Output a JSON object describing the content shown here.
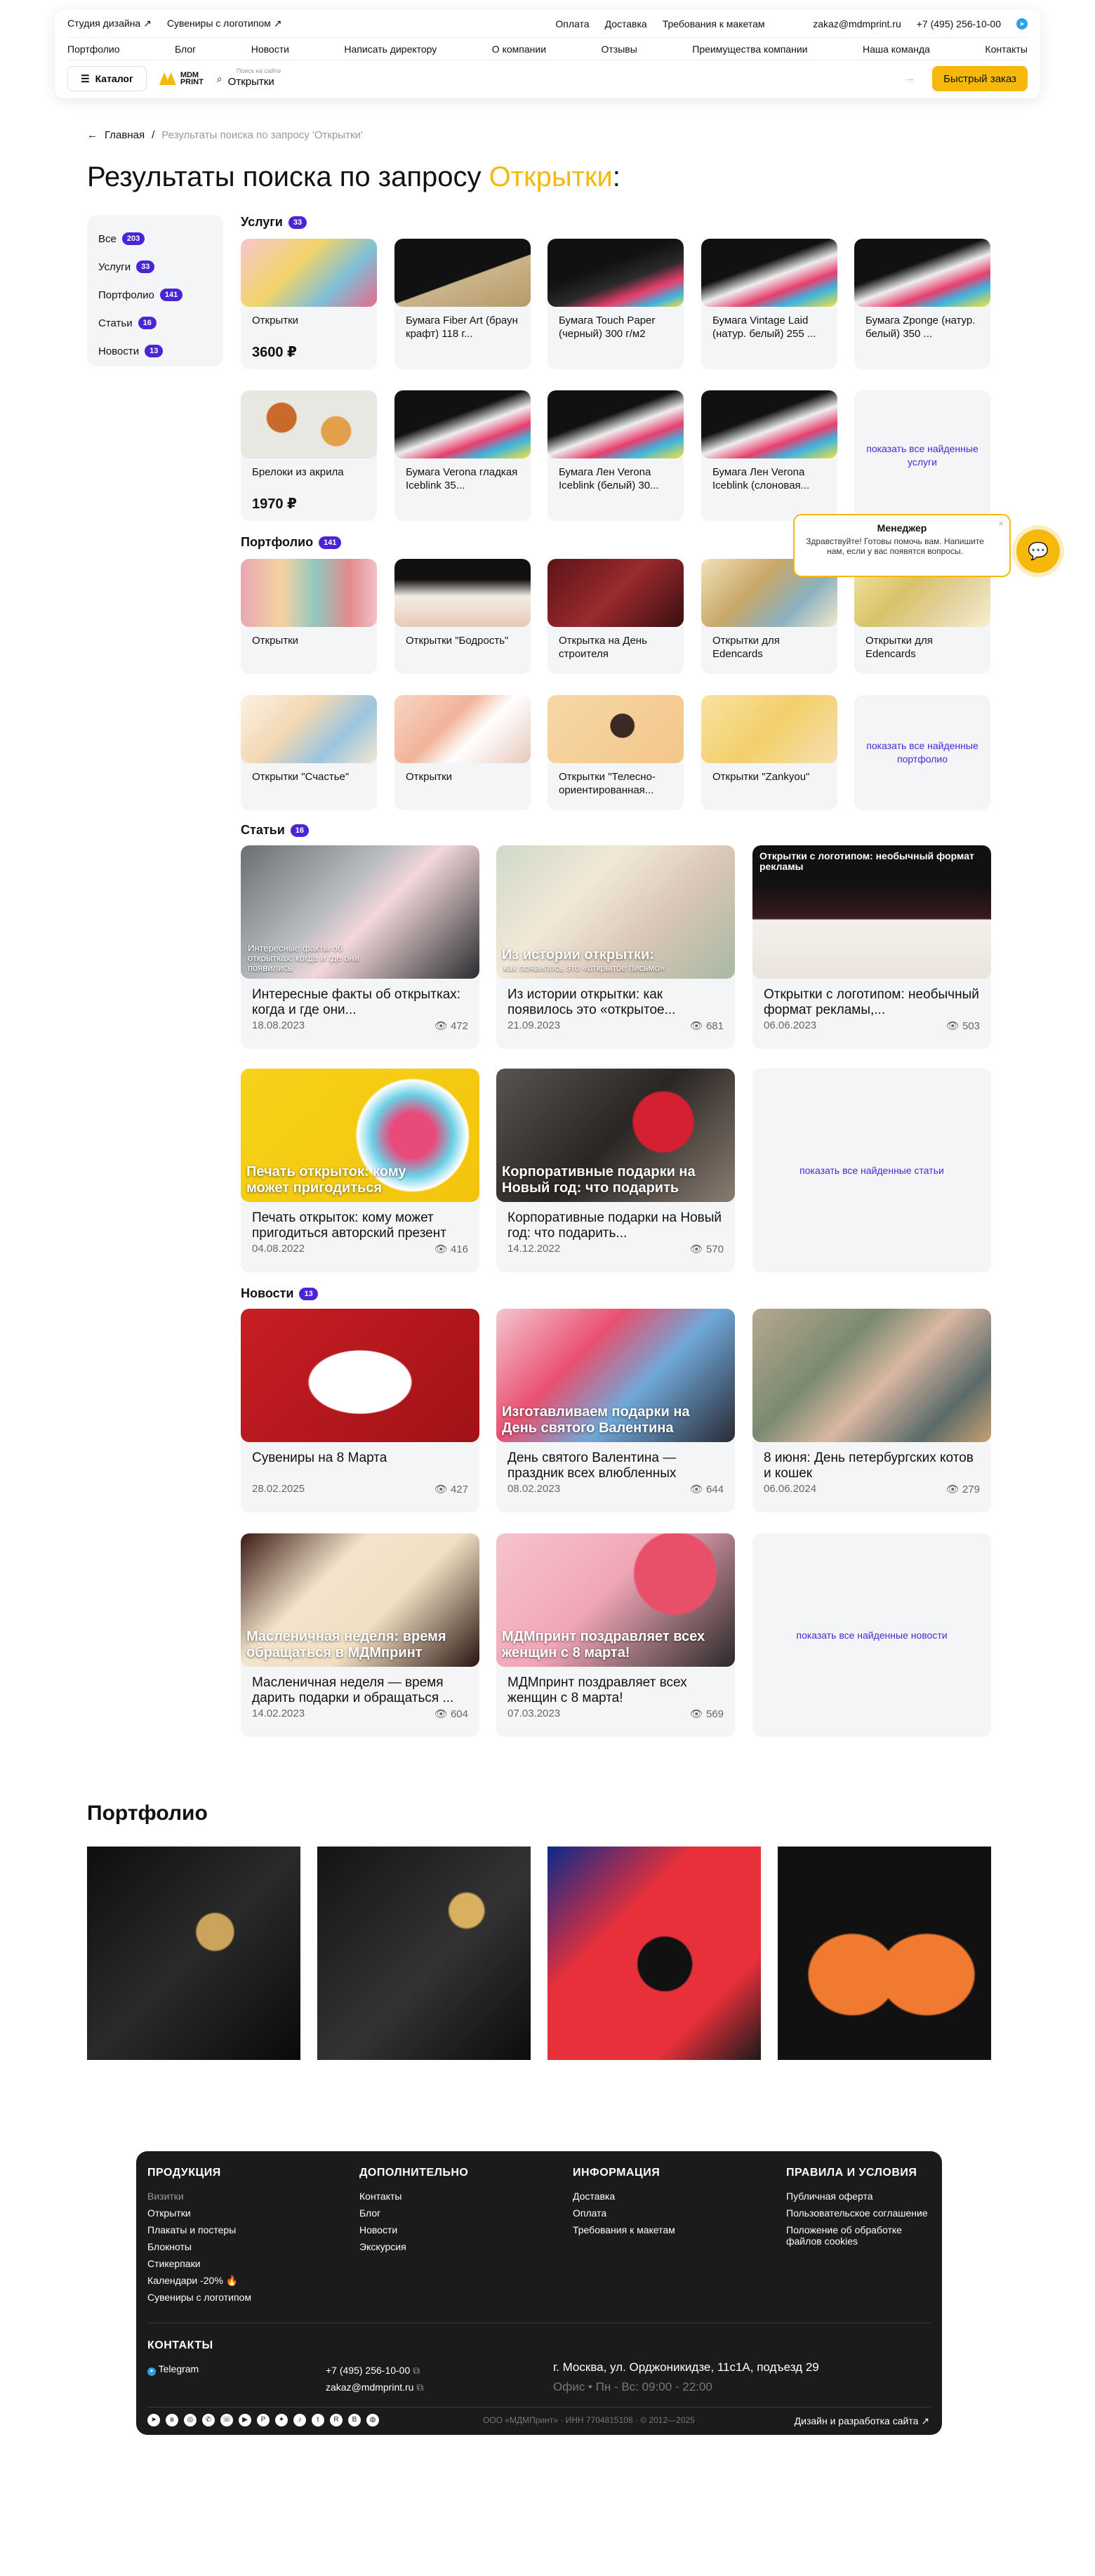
{
  "header": {
    "top_left": [
      "Студия дизайна ↗",
      "Сувениры с логотипом ↗"
    ],
    "top_mid": [
      "Оплата",
      "Доставка",
      "Требования к макетам"
    ],
    "email": "zakaz@mdmprint.ru",
    "phone": "+7 (495) 256-10-00",
    "nav": [
      "Портфолио",
      "Блог",
      "Новости",
      "Написать директору",
      "О компании",
      "Отзывы",
      "Преимущества компании",
      "Наша команда",
      "Контакты"
    ],
    "catalog_label": "Каталог",
    "logo_text": "MDM PRINT",
    "search_placeholder": "Поиск на сайте",
    "search_value": "Открытки",
    "quick_order": "Быстрый заказ"
  },
  "breadcrumb": {
    "home": "Главная",
    "current": "Результаты поиска по запросу 'Открытки'"
  },
  "title": {
    "prefix": "Результаты поиска по запросу ",
    "query": "Открытки",
    "suffix": ":"
  },
  "sidebar": [
    {
      "label": "Все",
      "count": "203"
    },
    {
      "label": "Услуги",
      "count": "33"
    },
    {
      "label": "Портфолио",
      "count": "141"
    },
    {
      "label": "Статьи",
      "count": "16"
    },
    {
      "label": "Новости",
      "count": "13"
    }
  ],
  "services": {
    "label": "Услуги",
    "count": "33",
    "items": [
      {
        "title": "Открытки",
        "price": "3600 ₽"
      },
      {
        "title": "Бумага Fiber Art (браун крафт) 118 г...",
        "price": ""
      },
      {
        "title": "Бумага Touch Paper (черный) 300 г/м2",
        "price": ""
      },
      {
        "title": "Бумага Vintage Laid (натур. белый) 255 ...",
        "price": ""
      },
      {
        "title": "Бумага Zponge (натур. белый) 350 ...",
        "price": ""
      },
      {
        "title": "Брелоки из акрила",
        "price": "1970 ₽"
      },
      {
        "title": "Бумага Verona гладкая Iceblink 35...",
        "price": ""
      },
      {
        "title": "Бумага Лен Verona Iceblink (белый) 30...",
        "price": ""
      },
      {
        "title": "Бумага Лен Verona Iceblink (слоновая...",
        "price": ""
      }
    ],
    "show_more": "показать все найденные услуги"
  },
  "portfolio": {
    "label": "Портфолио",
    "count": "141",
    "items": [
      "Открытки",
      "Открытки \"Бодрость\"",
      "Открытка на День строителя",
      "Открытки для Edencards",
      "Открытки для Edencards",
      "Открытки \"Счастье\"",
      "Открытки",
      "Открытки \"Телесно-ориентированная...",
      "Открытки \"Zankyou\""
    ],
    "show_more": "показать все найденные портфолио"
  },
  "articles": {
    "label": "Статьи",
    "count": "16",
    "items": [
      {
        "title": "Интересные факты об открытках: когда и где они...",
        "date": "18.08.2023",
        "views": "472",
        "overlay_small": "Интересные факты об открытках: когда и где они появились"
      },
      {
        "title": "Из истории открытки: как появилось это «открытое...",
        "date": "21.09.2023",
        "views": "681",
        "overlay": "Из истории открытки:",
        "overlay_small": "как появилось это «открытое письмо»"
      },
      {
        "title": "Открытки с логотипом: необычный формат рекламы,...",
        "date": "06.06.2023",
        "views": "503",
        "overlay_top": "Открытки с логотипом: необычный формат рекламы"
      },
      {
        "title": "Печать открыток: кому может пригодиться авторский презент",
        "date": "04.08.2022",
        "views": "416",
        "overlay": "Печать открыток: кому может пригодиться"
      },
      {
        "title": "Корпоративные подарки на Новый год: что подарить...",
        "date": "14.12.2022",
        "views": "570",
        "overlay": "Корпоративные подарки на Новый год: что подарить"
      }
    ],
    "show_more": "показать все найденные статьи"
  },
  "news": {
    "label": "Новости",
    "count": "13",
    "items": [
      {
        "title": "Сувениры на 8 Марта",
        "date": "28.02.2025",
        "views": "427"
      },
      {
        "title": "День святого Валентина — праздник всех влюбленных",
        "date": "08.02.2023",
        "views": "644",
        "overlay": "Изготавливаем подарки на День святого Валентина"
      },
      {
        "title": "8 июня: День петербургских котов и кошек",
        "date": "06.06.2024",
        "views": "279"
      },
      {
        "title": "Масленичная неделя — время дарить подарки и обращаться ...",
        "date": "14.02.2023",
        "views": "604",
        "overlay": "Масленичная неделя: время обращаться в МДМпринт"
      },
      {
        "title": "МДМпринт поздравляет всех женщин с 8 марта!",
        "date": "07.03.2023",
        "views": "569",
        "overlay": "МДМпринт поздравляет всех женщин с 8 марта!"
      }
    ],
    "show_more": "показать все найденные новости"
  },
  "chat": {
    "title": "Менеджер",
    "message": "Здравствуйте! Готовы помочь вам. Напишите нам, если у вас появятся вопросы."
  },
  "portfolio_bottom": {
    "title": "Портфолио"
  },
  "footer": {
    "col1": {
      "title": "ПРОДУКЦИЯ",
      "links": [
        "Визитки",
        "Открытки",
        "Плакаты и постеры",
        "Блокноты",
        "Стикерпаки",
        "Календари -20% 🔥",
        "Сувениры с логотипом"
      ]
    },
    "col2": {
      "title": "ДОПОЛНИТЕЛЬНО",
      "links": [
        "Контакты",
        "Блог",
        "Новости",
        "Экскурсия"
      ]
    },
    "col3": {
      "title": "ИНФОРМАЦИЯ",
      "links": [
        "Доставка",
        "Оплата",
        "Требования к макетам"
      ]
    },
    "col4": {
      "title": "ПРАВИЛА И УСЛОВИЯ",
      "links": [
        "Публичная оферта",
        "Пользовательское соглашение",
        "Положение об обработке файлов cookies"
      ]
    },
    "contacts_title": "КОНТАКТЫ",
    "telegram": "Telegram",
    "phone": "+7 (495) 256-10-00",
    "email": "zakaz@mdmprint.ru",
    "address": "г. Москва, ул. Орджоникидзе, 11с1А, подъезд 29",
    "hours": "Офис • Пн - Вс: 09:00 - 22:00",
    "company": "ООО «МДМПринт»  ·  ИНН 7704815108  ·  © 2012—2025",
    "dev": "Дизайн и разработка сайта ↗"
  }
}
